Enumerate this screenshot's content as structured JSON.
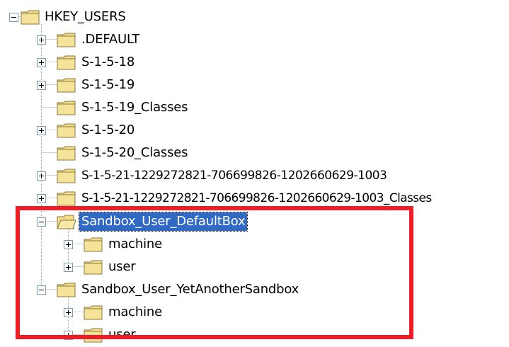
{
  "tree": {
    "root": {
      "label": "HKEY_USERS",
      "expanded": true,
      "icon": "folder-icon"
    },
    "children": [
      {
        "label": ".DEFAULT",
        "expander": "plus"
      },
      {
        "label": "S-1-5-18",
        "expander": "plus"
      },
      {
        "label": "S-1-5-19",
        "expander": "plus"
      },
      {
        "label": "S-1-5-19_Classes",
        "expander": "none"
      },
      {
        "label": "S-1-5-20",
        "expander": "plus"
      },
      {
        "label": "S-1-5-20_Classes",
        "expander": "none"
      },
      {
        "label": "S-1-5-21-1229272821-706699826-1202660629-1003",
        "expander": "plus"
      },
      {
        "label": "S-1-5-21-1229272821-706699826-1202660629-1003_Classes",
        "expander": "plus"
      },
      {
        "label": "Sandbox_User_DefaultBox",
        "expander": "minus",
        "selected": true,
        "icon": "open-folder-icon",
        "children": [
          {
            "label": "machine",
            "expander": "plus"
          },
          {
            "label": "user",
            "expander": "plus"
          }
        ]
      },
      {
        "label": "Sandbox_User_YetAnotherSandbox",
        "expander": "minus",
        "children": [
          {
            "label": "machine",
            "expander": "plus"
          },
          {
            "label": "user",
            "expander": "plus"
          }
        ]
      }
    ]
  },
  "colors": {
    "selection": "#316ac5",
    "highlight_border": "#ee1c25",
    "folder_fill": "#f3dc8a",
    "folder_edge": "#8a7a3a",
    "connector": "#a0a0a0"
  }
}
